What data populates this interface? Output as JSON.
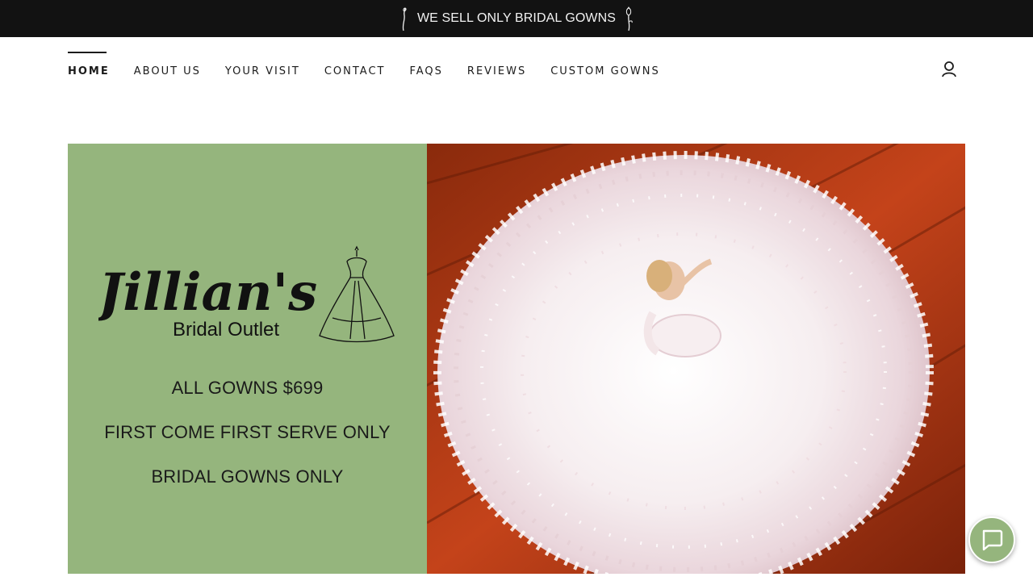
{
  "announcement": {
    "text": "WE SELL ONLY BRIDAL GOWNS",
    "icon_left": "rose-stem-icon",
    "icon_right": "rose-bud-icon"
  },
  "nav": {
    "items": [
      {
        "label": "HOME",
        "active": true
      },
      {
        "label": "ABOUT US"
      },
      {
        "label": "YOUR VISIT"
      },
      {
        "label": "CONTACT"
      },
      {
        "label": "FAQS"
      },
      {
        "label": "REVIEWS"
      },
      {
        "label": "CUSTOM GOWNS"
      }
    ],
    "account_icon": "user-icon"
  },
  "hero": {
    "logo": {
      "script": "Jillian's",
      "subtitle": "Bridal Outlet",
      "icon": "dress-form-icon"
    },
    "lines": [
      "ALL GOWNS $699",
      "FIRST COME FIRST SERVE ONLY",
      "BRIDAL GOWNS ONLY"
    ],
    "photo": "bride-in-gown-photo"
  },
  "chat": {
    "icon": "chat-bubble-icon"
  },
  "colors": {
    "announce_bg": "#121212",
    "accent_green": "#95b57d",
    "text": "#1b1b1b"
  }
}
